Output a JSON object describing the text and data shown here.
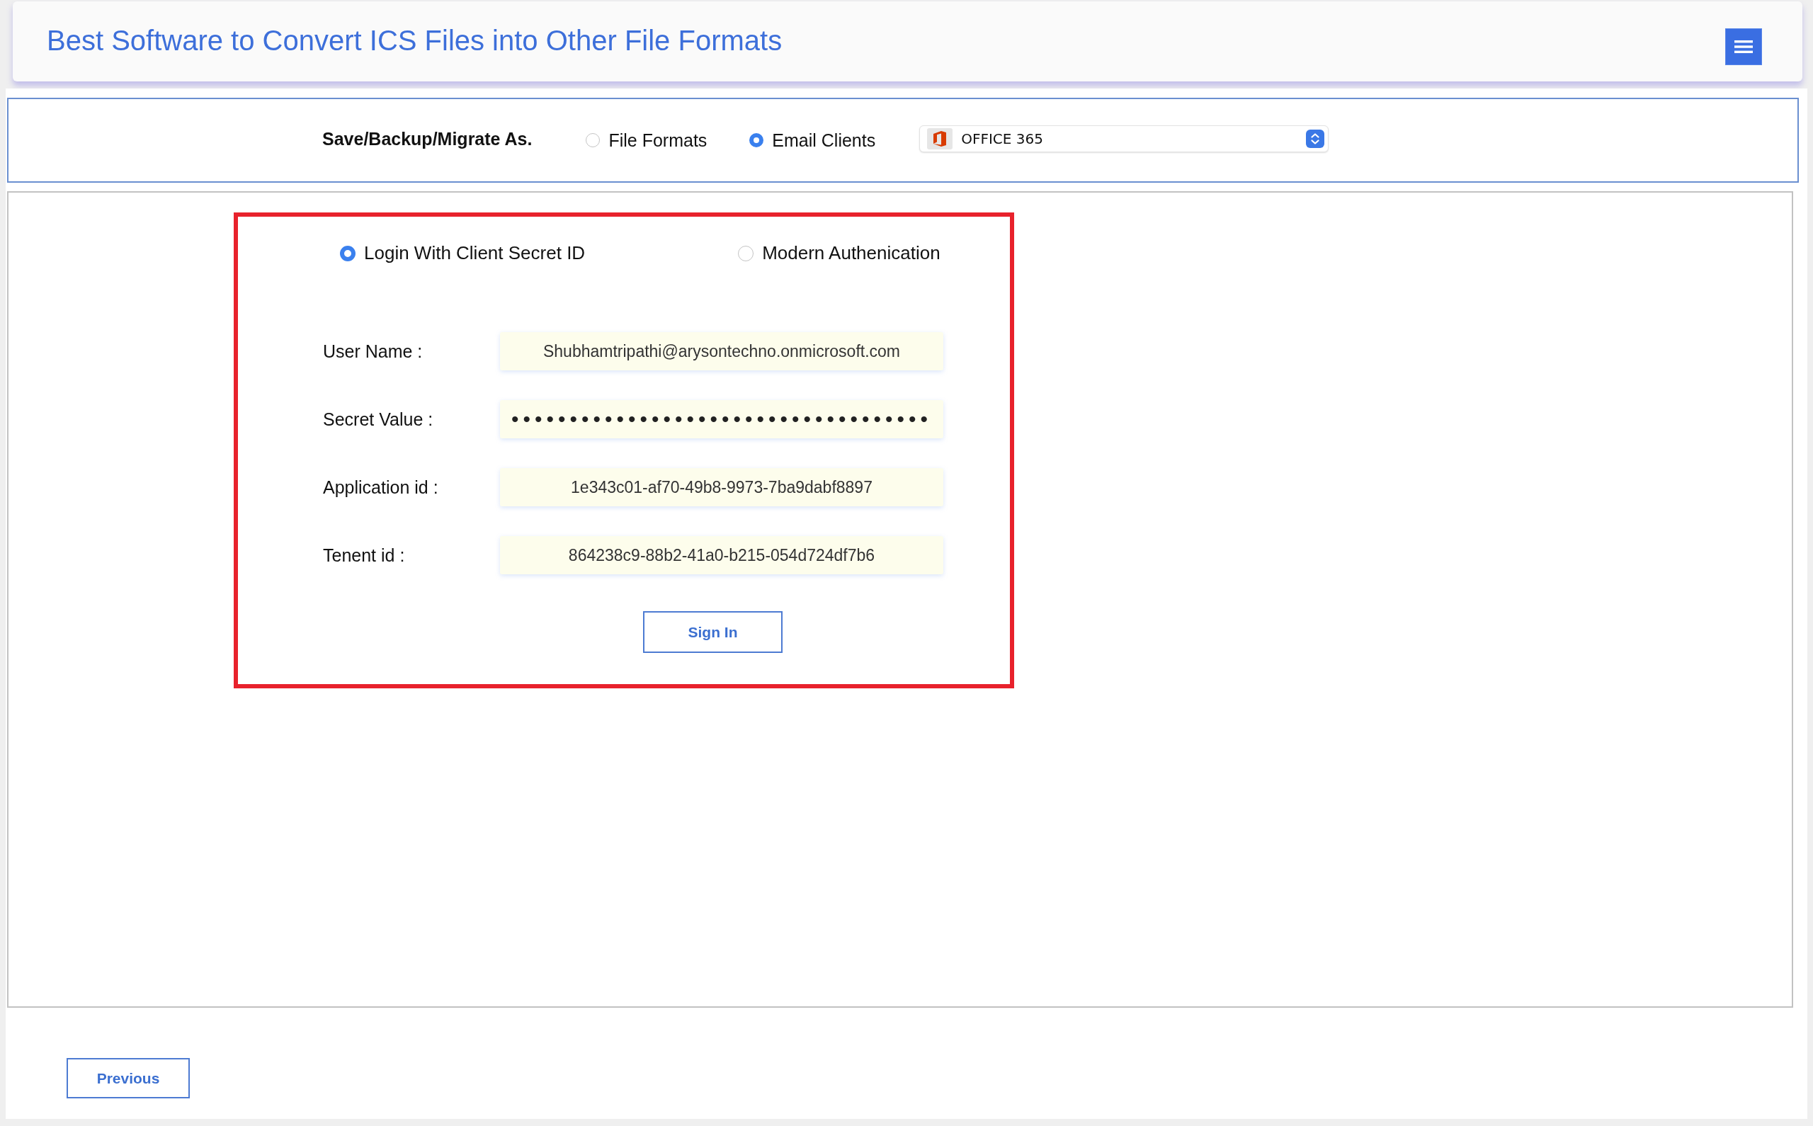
{
  "header": {
    "title": "Best Software to Convert ICS Files into Other File Formats"
  },
  "save_as": {
    "label": "Save/Backup/Migrate As.",
    "options": [
      {
        "label": "File Formats",
        "selected": false
      },
      {
        "label": "Email Clients",
        "selected": true
      }
    ],
    "client_select": {
      "value": "OFFICE 365"
    }
  },
  "login": {
    "methods": [
      {
        "label": "Login With Client Secret ID",
        "selected": true
      },
      {
        "label": "Modern Authenication",
        "selected": false
      }
    ],
    "fields": [
      {
        "kind": "text",
        "label": "User Name :",
        "value": "Shubhamtripathi@arysontechno.onmicrosoft.com"
      },
      {
        "kind": "password",
        "label": "Secret Value :",
        "value": "••••••••••••••••••••••••••••••••••••"
      },
      {
        "kind": "text",
        "label": "Application id :",
        "value": "1e343c01-af70-49b8-9973-7ba9dabf8897"
      },
      {
        "kind": "text",
        "label": "Tenent id :",
        "value": "864238c9-88b2-41a0-b215-054d724df7b6"
      }
    ],
    "sign_in_button": "Sign In"
  },
  "footer": {
    "previous_button": "Previous"
  }
}
